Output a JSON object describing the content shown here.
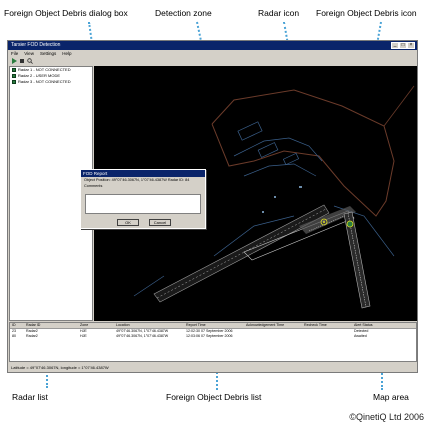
{
  "callouts": {
    "dialog_box": "Foreign Object Debris dialog box",
    "detection_zone": "Detection zone",
    "radar_icon": "Radar icon",
    "fod_icon": "Foreign Object Debris icon",
    "radar_list": "Radar list",
    "fod_list": "Foreign Object Debris list",
    "map_area": "Map area"
  },
  "copyright": "©QinetiQ Ltd 2006",
  "colors": {
    "map_background": "#000000",
    "detection_zone": "#c8c8c8",
    "fod_marker": "#e0e020",
    "radar_icon": "#2a7d3f",
    "titlebar": "#0a246a",
    "callout_dots": "#4aa3d6"
  },
  "app": {
    "title": "Tarsier FOD Detection",
    "menu": [
      "File",
      "View",
      "Settings",
      "Help"
    ],
    "radars": [
      {
        "label": "Radar 1 - NOT CONNECTED"
      },
      {
        "label": "Radar 2 - USER MODE"
      },
      {
        "label": "Radar 3 - NOT CONNECTED"
      }
    ],
    "fod_columns": [
      "ID",
      "Radar ID",
      "Zone",
      "Location",
      "Report Time",
      "Acknowledgement Time",
      "Recheck Time",
      "Alert Status"
    ],
    "fod_rows": [
      [
        "23",
        "Radar2",
        "HJE",
        "49°07'46.3067N, 1°07'46.4387W",
        "12:02:30 07 September 2006",
        "",
        "",
        "Detected"
      ],
      [
        "80",
        "Radar2",
        "HJE",
        "49°07'46.3067N, 1°07'46.4387W",
        "12:03:06 07 September 2006",
        "",
        "",
        "Awaited"
      ]
    ],
    "status": "Latitude = 49°07'46.3067N, longitude = 1°07'46.4387W"
  },
  "dialog": {
    "title": "FOD Report",
    "position_line": "Object Position: 49°07'46.3067N, 1°07'46.4387W    Radar ID: 84",
    "comments_label": "Comments",
    "ok_label": "OK",
    "cancel_label": "Cancel"
  }
}
